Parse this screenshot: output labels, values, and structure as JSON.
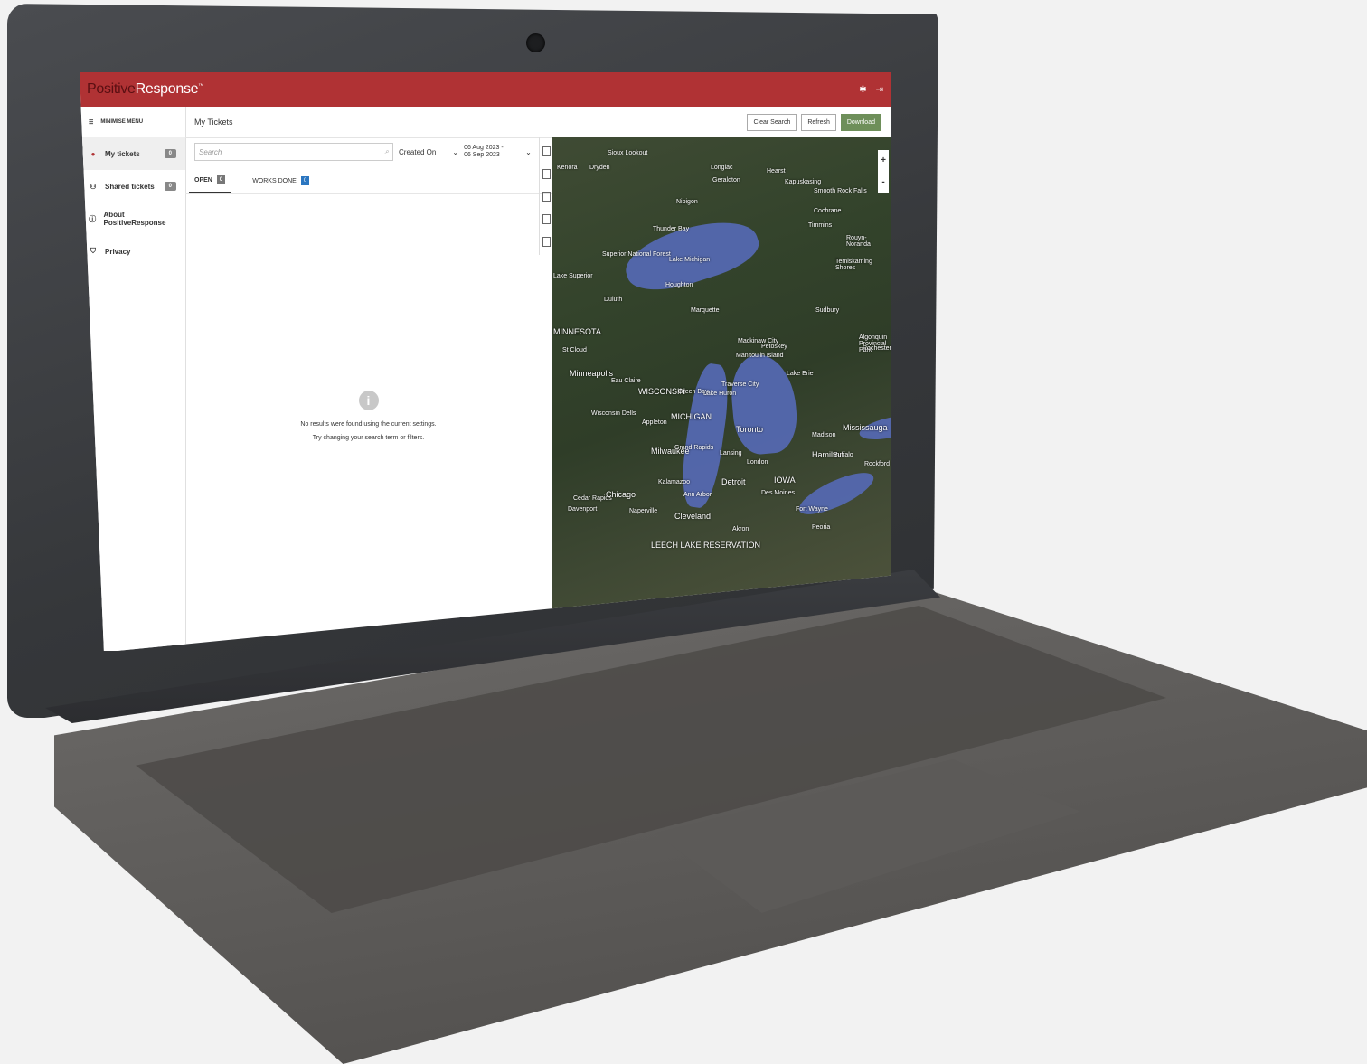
{
  "app": {
    "logo_part1": "Positive",
    "logo_part2": "Response",
    "logo_tm": "™"
  },
  "sidebar": {
    "toggle_label": "MINIMISE MENU",
    "items": [
      {
        "label": "My tickets",
        "badge": "0"
      },
      {
        "label": "Shared tickets",
        "badge": "0"
      },
      {
        "label": "About PositiveResponse"
      },
      {
        "label": "Privacy"
      }
    ]
  },
  "header": {
    "title": "My Tickets",
    "clear_label": "Clear Search",
    "refresh_label": "Refresh",
    "download_label": "Download"
  },
  "filters": {
    "search_placeholder": "Search",
    "sort_label": "Created On",
    "date_range": "06 Aug 2023 - 06 Sep 2023"
  },
  "tabs": [
    {
      "label": "OPEN",
      "count": "0"
    },
    {
      "label": "WORKS DONE",
      "count": "0"
    }
  ],
  "empty_state": {
    "title": "No results were found using the current settings.",
    "subtitle": "Try changing your search term or filters."
  },
  "map": {
    "zoom_in": "+",
    "zoom_out": "-",
    "labels": [
      "Sioux Lookout",
      "Kenora",
      "Dryden",
      "Thunder Bay",
      "Longlac",
      "Geraldton",
      "Nipigon",
      "Hearst",
      "Kapuskasing",
      "Smooth Rock Falls",
      "Cochrane",
      "Timmins",
      "Rouyn-Noranda",
      "Superior National Forest",
      "Duluth",
      "Houghton",
      "Marquette",
      "Temiskaming Shores",
      "Sudbury",
      "MINNESOTA",
      "St Cloud",
      "Minneapolis",
      "Eau Claire",
      "WISCONSIN",
      "Green Bay",
      "Traverse City",
      "Mackinaw City",
      "Petoskey",
      "Manitoulin Island",
      "Algonquin Provincial Park",
      "Rochester",
      "Wisconsin Dells",
      "Appleton",
      "MICHIGAN",
      "Toronto",
      "Mississauga",
      "Madison",
      "Milwaukee",
      "Grand Rapids",
      "Lansing",
      "London",
      "Hamilton",
      "Buffalo",
      "Rockford",
      "Kalamazoo",
      "Detroit",
      "IOWA",
      "Cedar Rapids",
      "Chicago",
      "Ann Arbor",
      "Des Moines",
      "Davenport",
      "Naperville",
      "Cleveland",
      "Fort Wayne",
      "Akron",
      "Peoria",
      "LEECH LAKE RESERVATION",
      "Lake Superior",
      "Lake Michigan",
      "Lake Huron",
      "Lake Erie"
    ]
  }
}
